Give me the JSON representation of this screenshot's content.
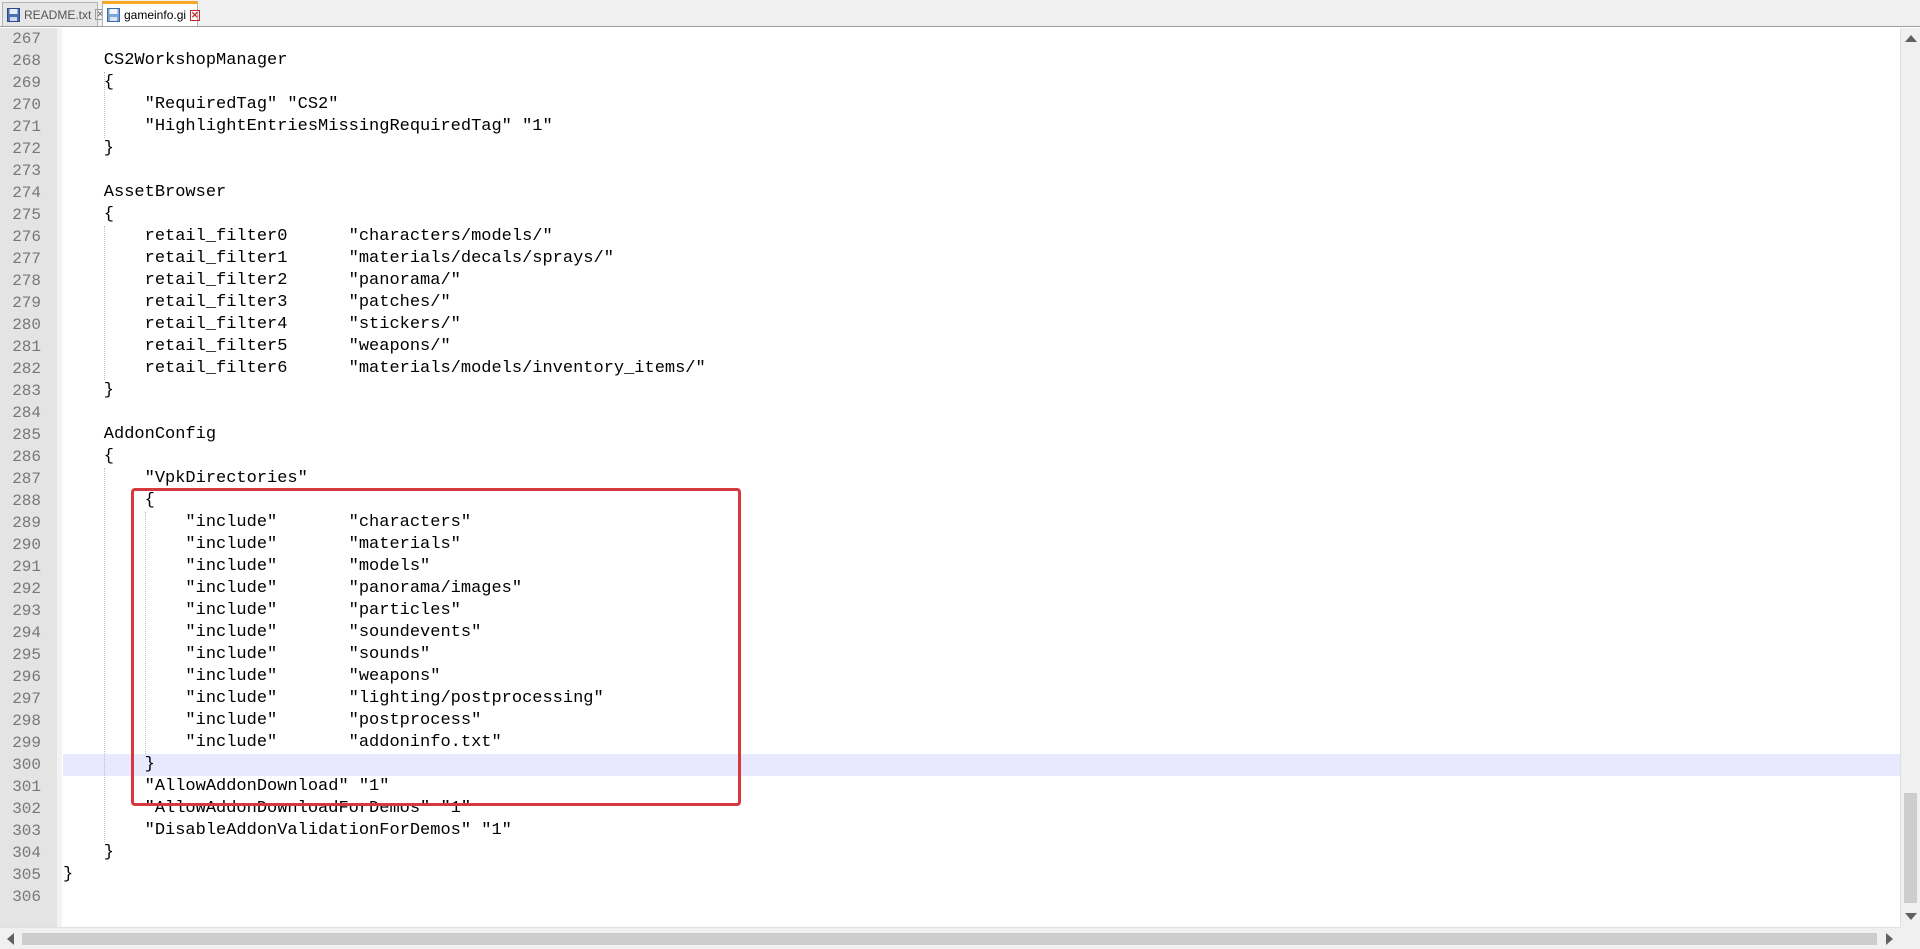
{
  "tabs": [
    {
      "label": "README.txt",
      "active": false
    },
    {
      "label": "gameinfo.gi",
      "active": true
    }
  ],
  "editor": {
    "current_line": 300,
    "lines": [
      {
        "n": "267",
        "text": ""
      },
      {
        "n": "268",
        "text": "    CS2WorkshopManager"
      },
      {
        "n": "269",
        "text": "    {"
      },
      {
        "n": "270",
        "text": "        \"RequiredTag\" \"CS2\""
      },
      {
        "n": "271",
        "text": "        \"HighlightEntriesMissingRequiredTag\" \"1\""
      },
      {
        "n": "272",
        "text": "    }"
      },
      {
        "n": "273",
        "text": ""
      },
      {
        "n": "274",
        "text": "    AssetBrowser"
      },
      {
        "n": "275",
        "text": "    {"
      },
      {
        "n": "276",
        "text": "        retail_filter0      \"characters/models/\""
      },
      {
        "n": "277",
        "text": "        retail_filter1      \"materials/decals/sprays/\""
      },
      {
        "n": "278",
        "text": "        retail_filter2      \"panorama/\""
      },
      {
        "n": "279",
        "text": "        retail_filter3      \"patches/\""
      },
      {
        "n": "280",
        "text": "        retail_filter4      \"stickers/\""
      },
      {
        "n": "281",
        "text": "        retail_filter5      \"weapons/\""
      },
      {
        "n": "282",
        "text": "        retail_filter6      \"materials/models/inventory_items/\""
      },
      {
        "n": "283",
        "text": "    }"
      },
      {
        "n": "284",
        "text": ""
      },
      {
        "n": "285",
        "text": "    AddonConfig"
      },
      {
        "n": "286",
        "text": "    {"
      },
      {
        "n": "287",
        "text": "        \"VpkDirectories\""
      },
      {
        "n": "288",
        "text": "        {"
      },
      {
        "n": "289",
        "text": "            \"include\"       \"characters\""
      },
      {
        "n": "290",
        "text": "            \"include\"       \"materials\""
      },
      {
        "n": "291",
        "text": "            \"include\"       \"models\""
      },
      {
        "n": "292",
        "text": "            \"include\"       \"panorama/images\""
      },
      {
        "n": "293",
        "text": "            \"include\"       \"particles\""
      },
      {
        "n": "294",
        "text": "            \"include\"       \"soundevents\""
      },
      {
        "n": "295",
        "text": "            \"include\"       \"sounds\""
      },
      {
        "n": "296",
        "text": "            \"include\"       \"weapons\""
      },
      {
        "n": "297",
        "text": "            \"include\"       \"lighting/postprocessing\""
      },
      {
        "n": "298",
        "text": "            \"include\"       \"postprocess\""
      },
      {
        "n": "299",
        "text": "            \"include\"       \"addoninfo.txt\""
      },
      {
        "n": "300",
        "text": "        }"
      },
      {
        "n": "301",
        "text": "        \"AllowAddonDownload\" \"1\""
      },
      {
        "n": "302",
        "text": "        \"AllowAddonDownloadForDemos\" \"1\""
      },
      {
        "n": "303",
        "text": "        \"DisableAddonValidationForDemos\" \"1\""
      },
      {
        "n": "304",
        "text": "    }"
      },
      {
        "n": "305",
        "text": "}"
      },
      {
        "n": "306",
        "text": ""
      }
    ]
  },
  "colors": {
    "highlight_box": "#d3393f",
    "current_line_bg": "#e8e8ff",
    "active_tab_accent": "#f9a825"
  },
  "icons": {
    "tab_file": "floppy-disk-icon",
    "tab_close": "close-icon"
  }
}
